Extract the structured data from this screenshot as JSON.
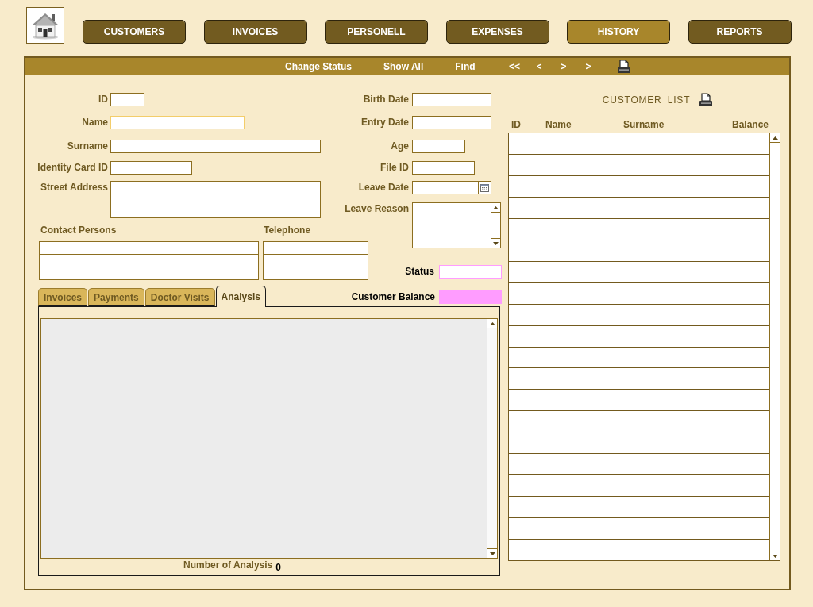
{
  "nav": [
    {
      "label": "CUSTOMERS",
      "selected": false
    },
    {
      "label": "INVOICES",
      "selected": false
    },
    {
      "label": "PERSONELL",
      "selected": false
    },
    {
      "label": "EXPENSES",
      "selected": false
    },
    {
      "label": "HISTORY",
      "selected": true
    },
    {
      "label": "REPORTS",
      "selected": false
    }
  ],
  "toolbar": [
    {
      "label": "Change Status",
      "kind": "text"
    },
    {
      "label": "Show All",
      "kind": "text"
    },
    {
      "label": "Find",
      "kind": "text"
    },
    {
      "label": "<<",
      "kind": "arrow"
    },
    {
      "label": "<",
      "kind": "arrow"
    },
    {
      "label": ">",
      "kind": "arrow"
    },
    {
      "label": ">",
      "kind": "arrow"
    }
  ],
  "form": {
    "left_fields": [
      {
        "label": "ID",
        "kind": "text",
        "focused": false
      },
      {
        "label": "Name",
        "kind": "text",
        "focused": true
      },
      {
        "label": "Surname",
        "kind": "text",
        "focused": false
      },
      {
        "label": "Identity Card ID",
        "kind": "text",
        "focused": false
      },
      {
        "label": "Street Address",
        "kind": "area",
        "focused": false
      }
    ],
    "right_fields": [
      {
        "label": "Birth Date",
        "kind": "text",
        "focused": false
      },
      {
        "label": "Entry Date",
        "kind": "text",
        "focused": false
      },
      {
        "label": "Age",
        "kind": "text",
        "focused": false
      },
      {
        "label": "File ID",
        "kind": "text",
        "focused": false
      },
      {
        "label": "Leave Date",
        "kind": "date",
        "focused": false
      },
      {
        "label": "Leave Reason",
        "kind": "memo",
        "focused": false
      }
    ],
    "contact_columns": [
      "Contact Persons",
      "Telephone"
    ],
    "status": {
      "label": "Status"
    },
    "customer_balance": {
      "label": "Customer Balance"
    }
  },
  "tabs": [
    {
      "label": "Invoices",
      "selected": false
    },
    {
      "label": "Payments",
      "selected": false
    },
    {
      "label": "Doctor Visits",
      "selected": false
    },
    {
      "label": "Analysis",
      "selected": true
    }
  ],
  "analysis": {
    "count_label": "Number of Analysis",
    "count": "0"
  },
  "customer_list": {
    "title": "CUSTOMER LIST",
    "columns": [
      "ID",
      "Name",
      "Surname",
      "Balance"
    ]
  }
}
